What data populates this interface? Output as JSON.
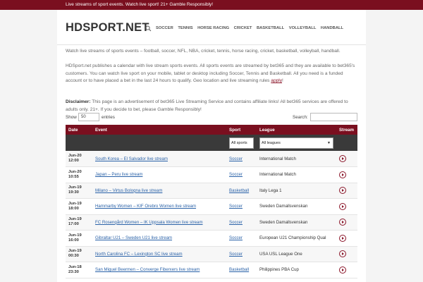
{
  "topbar": {
    "text": "Live streams of sport events. Watch live sport! 21+ Gamble Responsibly!"
  },
  "header": {
    "logo": "HDSPORT.NET"
  },
  "nav": {
    "items": [
      "SOCCER",
      "TENNIS",
      "HORSE RACING",
      "CRICKET",
      "BASKETBALL",
      "VOLLEYBALL",
      "HANDBALL"
    ]
  },
  "intro": {
    "p1": "Watch live streams of sports events – football, soccer, NFL, NBA, cricket, tennis, horse racing, cricket, basketball, volleyball, handball.",
    "p2_text": "HDSport.net publishes a calendar with live stream sports events. All sports events are streamed by bet365 and they are available to bet365's customers. You can watch live sport on your mobile, tablet or desktop including Soccer, Tennis and Basketball. All you need is a funded account or to have placed a bet in the last 24 hours to qualify. Geo location and live streaming rules ",
    "p2_link": "apply",
    "p2_end": "!",
    "disclaimer_label": "Disclaimer:",
    "disclaimer_text": " This page is an advertisement of bet365 Live Streaming Service and contains affiliate links! All bet365 services are offered to adults only. 21+. If you decide to bet, please Gamble Responsibly!"
  },
  "controls": {
    "show_label": "Show",
    "show_value": "50",
    "entries_label": "entries",
    "search_label": "Search:",
    "search_value": ""
  },
  "table": {
    "headers": {
      "date": "Date",
      "event": "Event",
      "sport": "Sport",
      "league": "League",
      "stream": "Stream"
    },
    "filters": {
      "sport": "All sports",
      "league": "All leagues"
    },
    "rows": [
      {
        "day": "Jun-20",
        "time": "12:00",
        "event": "South Korea – El Salvador live stream",
        "sport": "Soccer",
        "league": "International Match"
      },
      {
        "day": "Jun-20",
        "time": "10:55",
        "event": "Japan – Peru live stream",
        "sport": "Soccer",
        "league": "International Match"
      },
      {
        "day": "Jun-19",
        "time": "19:30",
        "event": "Milano – Virtus Bologna live stream",
        "sport": "Basketball",
        "league": "Italy Lega 1"
      },
      {
        "day": "Jun-19",
        "time": "18:00",
        "event": "Hammarby Women – KIF Orebro Women live stream",
        "sport": "Soccer",
        "league": "Sweden Damallsvenskan"
      },
      {
        "day": "Jun-19",
        "time": "17:00",
        "event": "FC Rosengård Women – IK Uppsala Women live stream",
        "sport": "Soccer",
        "league": "Sweden Damallsvenskan"
      },
      {
        "day": "Jun-19",
        "time": "16:00",
        "event": "Gibraltar U21 – Sweden U21 live stream",
        "sport": "Soccer",
        "league": "European U21 Championship Qual"
      },
      {
        "day": "Jun-19",
        "time": "00:30",
        "event": "North Carolina FC – Lexington SC live stream",
        "sport": "Soccer",
        "league": "USA USL League One"
      },
      {
        "day": "Jun-18",
        "time": "23:30",
        "event": "San Miguel Beermen – Converge Fiberxers live stream",
        "sport": "Basketball",
        "league": "Philippines PBA Cup"
      }
    ]
  }
}
